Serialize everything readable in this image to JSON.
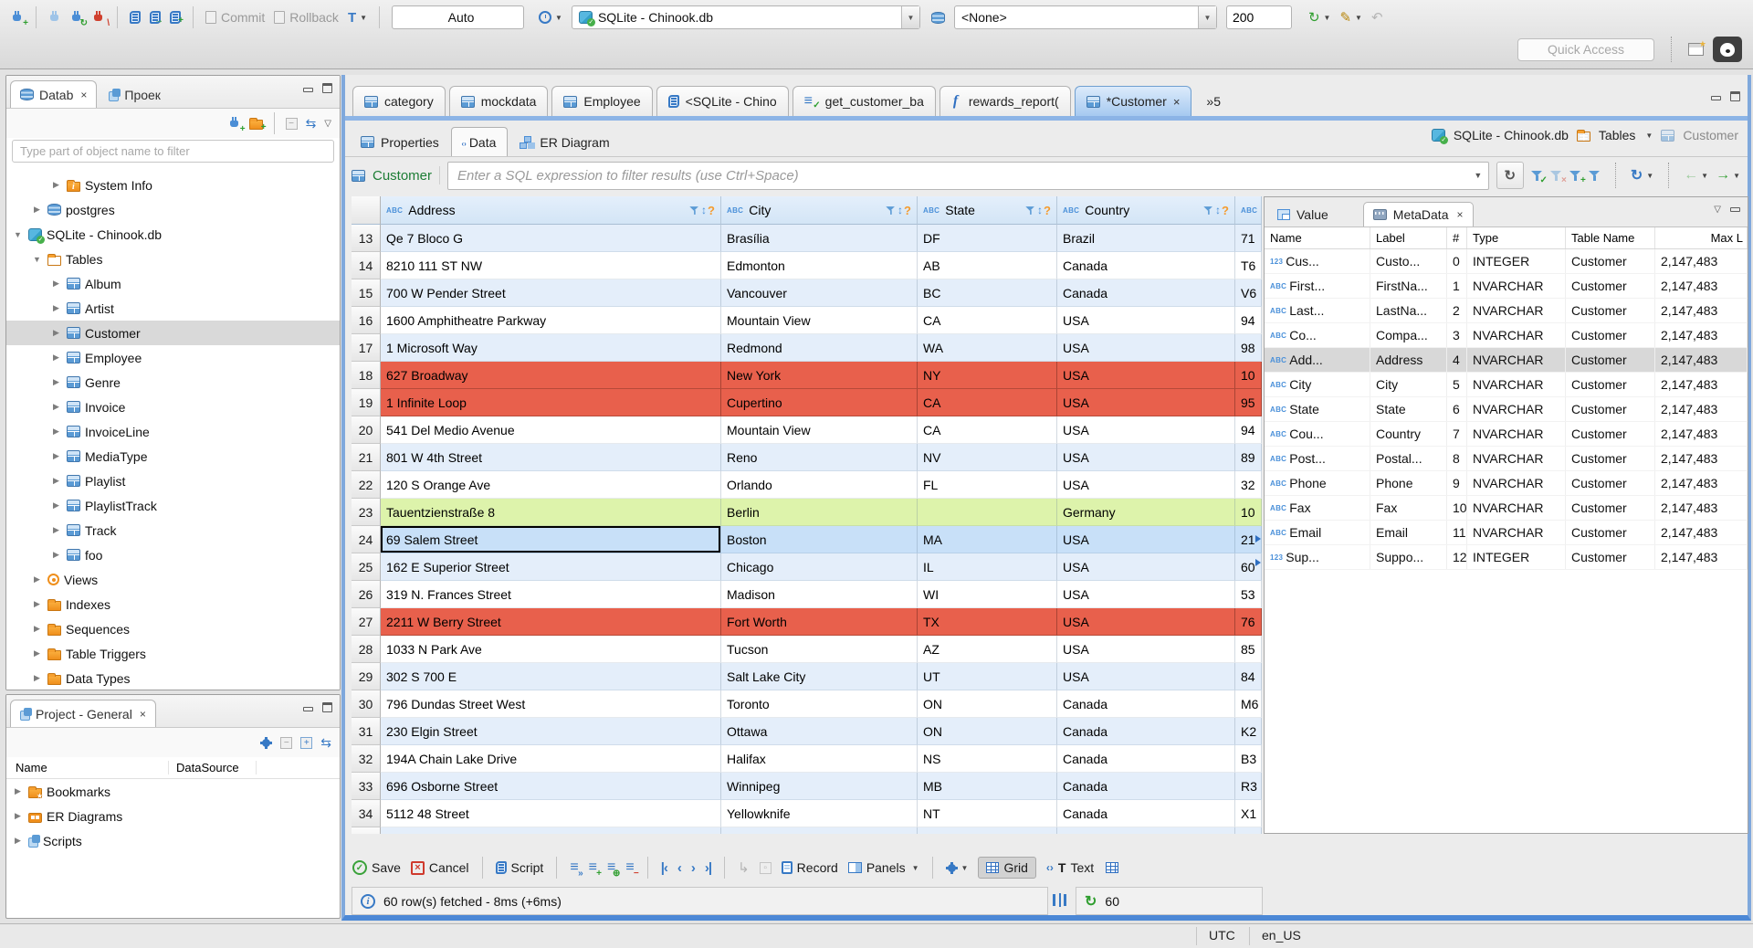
{
  "topbar": {
    "commit": "Commit",
    "rollback": "Rollback",
    "auto_mode": "Auto",
    "connection": "SQLite - Chinook.db",
    "schema": "<None>",
    "fetch_size": "200",
    "quick_access_placeholder": "Quick Access"
  },
  "navigator": {
    "tab_database": "Datab",
    "tab_projects": "Проек",
    "filter_placeholder": "Type part of object name to filter",
    "tree": [
      {
        "arrow": "▶",
        "icon": "info-folder",
        "label": "System Info",
        "indent": 2
      },
      {
        "arrow": "▶",
        "icon": "db",
        "label": "postgres",
        "indent": 1
      },
      {
        "arrow": "▼",
        "icon": "db-check",
        "label": "SQLite - Chinook.db",
        "indent": 0
      },
      {
        "arrow": "▼",
        "icon": "folder-table",
        "label": "Tables",
        "indent": 1
      },
      {
        "arrow": "▶",
        "icon": "table",
        "label": "Album",
        "indent": 2
      },
      {
        "arrow": "▶",
        "icon": "table",
        "label": "Artist",
        "indent": 2
      },
      {
        "arrow": "▶",
        "icon": "table",
        "label": "Customer",
        "indent": 2,
        "cls": "selected"
      },
      {
        "arrow": "▶",
        "icon": "table",
        "label": "Employee",
        "indent": 2
      },
      {
        "arrow": "▶",
        "icon": "table",
        "label": "Genre",
        "indent": 2
      },
      {
        "arrow": "▶",
        "icon": "table",
        "label": "Invoice",
        "indent": 2
      },
      {
        "arrow": "▶",
        "icon": "table",
        "label": "InvoiceLine",
        "indent": 2
      },
      {
        "arrow": "▶",
        "icon": "table",
        "label": "MediaType",
        "indent": 2
      },
      {
        "arrow": "▶",
        "icon": "table",
        "label": "Playlist",
        "indent": 2
      },
      {
        "arrow": "▶",
        "icon": "table",
        "label": "PlaylistTrack",
        "indent": 2
      },
      {
        "arrow": "▶",
        "icon": "table",
        "label": "Track",
        "indent": 2
      },
      {
        "arrow": "▶",
        "icon": "table",
        "label": "foo",
        "indent": 2
      },
      {
        "arrow": "▶",
        "icon": "eye",
        "label": "Views",
        "indent": 1
      },
      {
        "arrow": "▶",
        "icon": "folder",
        "label": "Indexes",
        "indent": 1
      },
      {
        "arrow": "▶",
        "icon": "folder",
        "label": "Sequences",
        "indent": 1
      },
      {
        "arrow": "▶",
        "icon": "folder",
        "label": "Table Triggers",
        "indent": 1
      },
      {
        "arrow": "▶",
        "icon": "folder",
        "label": "Data Types",
        "indent": 1
      }
    ]
  },
  "project_panel": {
    "title": "Project - General",
    "col_name": "Name",
    "col_datasource": "DataSource",
    "items": [
      {
        "arrow": "▶",
        "icon": "folder-star",
        "label": "Bookmarks"
      },
      {
        "arrow": "▶",
        "icon": "er",
        "label": "ER Diagrams"
      },
      {
        "arrow": "▶",
        "icon": "scripts",
        "label": "Scripts"
      }
    ]
  },
  "editor": {
    "tabs": [
      {
        "icon": "table",
        "label": "category"
      },
      {
        "icon": "table",
        "label": "mockdata"
      },
      {
        "icon": "table",
        "label": "Employee"
      },
      {
        "icon": "scroll",
        "label": "<SQLite - Chino"
      },
      {
        "icon": "script-check",
        "label": "get_customer_ba"
      },
      {
        "icon": "function",
        "label": "rewards_report("
      },
      {
        "icon": "table",
        "label": "*Customer",
        "cls": "active"
      }
    ],
    "overflow": "»5",
    "subtabs": [
      {
        "icon": "table",
        "label": "Properties"
      },
      {
        "icon": "table-code",
        "label": "Data",
        "cls": "active"
      },
      {
        "icon": "diagram",
        "label": "ER Diagram"
      }
    ],
    "breadcrumb": {
      "connection": "SQLite - Chinook.db",
      "container": "Tables",
      "entity": "Customer"
    }
  },
  "filter_bar": {
    "entity": "Customer",
    "placeholder": "Enter a SQL expression to filter results (use Ctrl+Space)"
  },
  "grid": {
    "columns": [
      {
        "type": "ABC",
        "name": "Address",
        "cls": "w-addr"
      },
      {
        "type": "ABC",
        "name": "City",
        "cls": "w-city"
      },
      {
        "type": "ABC",
        "name": "State",
        "cls": "w-state"
      },
      {
        "type": "ABC",
        "name": "Country",
        "cls": "w-ctry"
      },
      {
        "type": "ABC",
        "name": "",
        "cls": "w-post partial"
      }
    ],
    "rows": [
      {
        "n": "13",
        "address": "Qe 7 Bloco G",
        "city": "Brasília",
        "state": "DF",
        "country": "Brazil",
        "postal": "71",
        "cls": "v-blue"
      },
      {
        "n": "14",
        "address": "8210 111 ST NW",
        "city": "Edmonton",
        "state": "AB",
        "country": "Canada",
        "postal": "T6",
        "cls": "v-white"
      },
      {
        "n": "15",
        "address": "700 W Pender Street",
        "city": "Vancouver",
        "state": "BC",
        "country": "Canada",
        "postal": "V6",
        "cls": "v-blue"
      },
      {
        "n": "16",
        "address": "1600 Amphitheatre Parkway",
        "city": "Mountain View",
        "state": "CA",
        "country": "USA",
        "postal": "94",
        "cls": "v-white"
      },
      {
        "n": "17",
        "address": "1 Microsoft Way",
        "city": "Redmond",
        "state": "WA",
        "country": "USA",
        "postal": "98",
        "cls": "v-blue"
      },
      {
        "n": "18",
        "address": "627 Broadway",
        "city": "New York",
        "state": "NY",
        "country": "USA",
        "postal": "10",
        "cls": "v-red"
      },
      {
        "n": "19",
        "address": "1 Infinite Loop",
        "city": "Cupertino",
        "state": "CA",
        "country": "USA",
        "postal": "95",
        "cls": "v-red"
      },
      {
        "n": "20",
        "address": "541 Del Medio Avenue",
        "city": "Mountain View",
        "state": "CA",
        "country": "USA",
        "postal": "94",
        "cls": "v-white"
      },
      {
        "n": "21",
        "address": "801 W 4th Street",
        "city": "Reno",
        "state": "NV",
        "country": "USA",
        "postal": "89",
        "cls": "v-blue"
      },
      {
        "n": "22",
        "address": "120 S Orange Ave",
        "city": "Orlando",
        "state": "FL",
        "country": "USA",
        "postal": "32",
        "cls": "v-white"
      },
      {
        "n": "23",
        "address": "Tauentzienstraße 8",
        "city": "Berlin",
        "state": "",
        "country": "Germany",
        "postal": "10",
        "cls": "v-green"
      },
      {
        "n": "24",
        "address": "69 Salem Street",
        "city": "Boston",
        "state": "MA",
        "country": "USA",
        "postal": "21",
        "cls": "v-sel"
      },
      {
        "n": "25",
        "address": "162 E Superior Street",
        "city": "Chicago",
        "state": "IL",
        "country": "USA",
        "postal": "60",
        "cls": "v-blue"
      },
      {
        "n": "26",
        "address": "319 N. Frances Street",
        "city": "Madison",
        "state": "WI",
        "country": "USA",
        "postal": "53",
        "cls": "v-white"
      },
      {
        "n": "27",
        "address": "2211 W Berry Street",
        "city": "Fort Worth",
        "state": "TX",
        "country": "USA",
        "postal": "76",
        "cls": "v-red"
      },
      {
        "n": "28",
        "address": "1033 N Park Ave",
        "city": "Tucson",
        "state": "AZ",
        "country": "USA",
        "postal": "85",
        "cls": "v-white"
      },
      {
        "n": "29",
        "address": "302 S 700 E",
        "city": "Salt Lake City",
        "state": "UT",
        "country": "USA",
        "postal": "84",
        "cls": "v-blue"
      },
      {
        "n": "30",
        "address": "796 Dundas Street West",
        "city": "Toronto",
        "state": "ON",
        "country": "Canada",
        "postal": "M6",
        "cls": "v-white"
      },
      {
        "n": "31",
        "address": "230 Elgin Street",
        "city": "Ottawa",
        "state": "ON",
        "country": "Canada",
        "postal": "K2",
        "cls": "v-blue"
      },
      {
        "n": "32",
        "address": "194A Chain Lake Drive",
        "city": "Halifax",
        "state": "NS",
        "country": "Canada",
        "postal": "B3",
        "cls": "v-white"
      },
      {
        "n": "33",
        "address": "696 Osborne Street",
        "city": "Winnipeg",
        "state": "MB",
        "country": "Canada",
        "postal": "R3",
        "cls": "v-blue"
      },
      {
        "n": "34",
        "address": "5112 48 Street",
        "city": "Yellowknife",
        "state": "NT",
        "country": "Canada",
        "postal": "X1",
        "cls": "v-white"
      },
      {
        "n": "35",
        "address": "",
        "city": "",
        "state": "",
        "country": "",
        "postal": "",
        "cls": "v-blue"
      }
    ]
  },
  "metadata": {
    "tab_value": "Value",
    "tab_metadata": "MetaData",
    "columns": {
      "name": "Name",
      "label": "Label",
      "num": "#",
      "type": "Type",
      "table": "Table Name",
      "max": "Max L"
    },
    "rows": [
      {
        "dtype": "123",
        "name": "Cus...",
        "label": "Custo...",
        "num": "0",
        "type": "INTEGER",
        "table": "Customer",
        "max": "2,147,483"
      },
      {
        "dtype": "ABC",
        "name": "First...",
        "label": "FirstNa...",
        "num": "1",
        "type": "NVARCHAR",
        "table": "Customer",
        "max": "2,147,483"
      },
      {
        "dtype": "ABC",
        "name": "Last...",
        "label": "LastNa...",
        "num": "2",
        "type": "NVARCHAR",
        "table": "Customer",
        "max": "2,147,483"
      },
      {
        "dtype": "ABC",
        "name": "Co...",
        "label": "Compa...",
        "num": "3",
        "type": "NVARCHAR",
        "table": "Customer",
        "max": "2,147,483"
      },
      {
        "dtype": "ABC",
        "name": "Add...",
        "label": "Address",
        "num": "4",
        "type": "NVARCHAR",
        "table": "Customer",
        "max": "2,147,483",
        "cls": "selected"
      },
      {
        "dtype": "ABC",
        "name": "City",
        "label": "City",
        "num": "5",
        "type": "NVARCHAR",
        "table": "Customer",
        "max": "2,147,483"
      },
      {
        "dtype": "ABC",
        "name": "State",
        "label": "State",
        "num": "6",
        "type": "NVARCHAR",
        "table": "Customer",
        "max": "2,147,483"
      },
      {
        "dtype": "ABC",
        "name": "Cou...",
        "label": "Country",
        "num": "7",
        "type": "NVARCHAR",
        "table": "Customer",
        "max": "2,147,483"
      },
      {
        "dtype": "ABC",
        "name": "Post...",
        "label": "Postal...",
        "num": "8",
        "type": "NVARCHAR",
        "table": "Customer",
        "max": "2,147,483"
      },
      {
        "dtype": "ABC",
        "name": "Phone",
        "label": "Phone",
        "num": "9",
        "type": "NVARCHAR",
        "table": "Customer",
        "max": "2,147,483"
      },
      {
        "dtype": "ABC",
        "name": "Fax",
        "label": "Fax",
        "num": "10",
        "type": "NVARCHAR",
        "table": "Customer",
        "max": "2,147,483"
      },
      {
        "dtype": "ABC",
        "name": "Email",
        "label": "Email",
        "num": "11",
        "type": "NVARCHAR",
        "table": "Customer",
        "max": "2,147,483"
      },
      {
        "dtype": "123",
        "name": "Sup...",
        "label": "Suppo...",
        "num": "12",
        "type": "INTEGER",
        "table": "Customer",
        "max": "2,147,483"
      }
    ]
  },
  "result_toolbar": {
    "save": "Save",
    "cancel": "Cancel",
    "script": "Script",
    "record": "Record",
    "panels": "Panels",
    "grid": "Grid",
    "text": "Text"
  },
  "status": {
    "fetch": "60 row(s) fetched - 8ms (+6ms)",
    "refresh": "60"
  },
  "statusbar": {
    "timezone": "UTC",
    "locale": "en_US"
  }
}
